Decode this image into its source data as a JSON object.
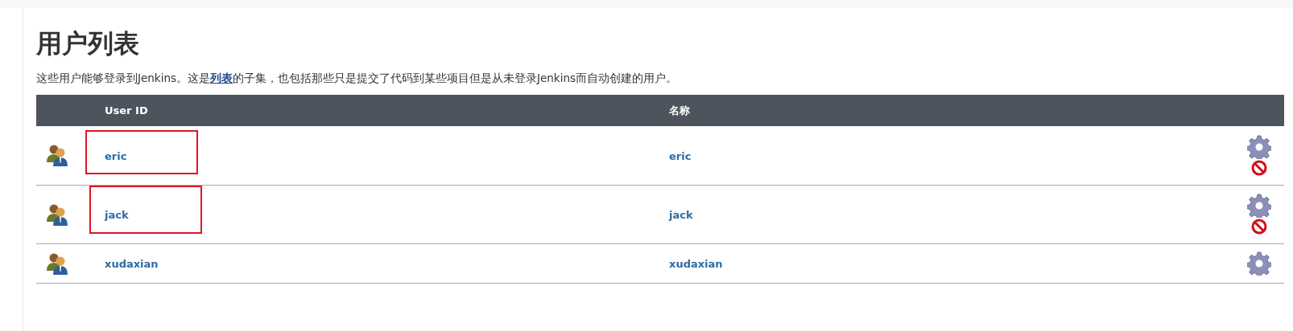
{
  "title": "用户列表",
  "description_parts": {
    "before": "这些用户能够登录到Jenkins。这是",
    "link": "列表",
    "after": "的子集，也包括那些只是提交了代码到某些项目但是从未登录Jenkins而自动创建的用户。"
  },
  "table": {
    "columns": [
      "User ID",
      "名称"
    ],
    "rows": [
      {
        "user_id": "eric",
        "name": "eric",
        "deletable": true,
        "highlighted": true
      },
      {
        "user_id": "jack",
        "name": "jack",
        "deletable": true,
        "highlighted": true
      },
      {
        "user_id": "xudaxian",
        "name": "xudaxian",
        "deletable": false,
        "highlighted": false
      }
    ]
  }
}
